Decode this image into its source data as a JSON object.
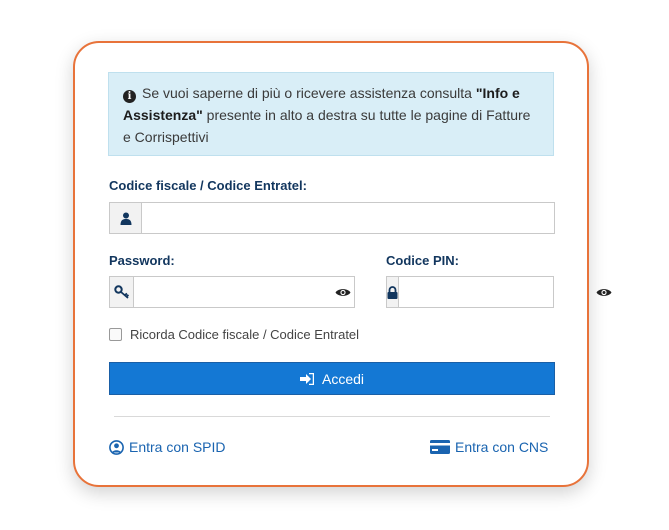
{
  "info": {
    "text_before": "Se vuoi saperne di più o ricevere assistenza consulta ",
    "bold": "\"Info e Assistenza\"",
    "text_after": " presente in alto a destra su tutte le pagine di Fatture e Corrispettivi"
  },
  "fiscal_code": {
    "label": "Codice fiscale / Codice Entratel:",
    "value": ""
  },
  "password": {
    "label": "Password:",
    "value": ""
  },
  "pin": {
    "label": "Codice PIN:",
    "value": ""
  },
  "remember": {
    "label": "Ricorda Codice fiscale / Codice Entratel",
    "checked": false
  },
  "login_button": {
    "label": "Accedi"
  },
  "spid_link": {
    "label": "Entra con SPID"
  },
  "cns_link": {
    "label": "Entra con CNS"
  },
  "colors": {
    "accent": "#1478d4",
    "border": "#e8733a",
    "label": "#12365e",
    "info_bg": "#d9eef7"
  }
}
